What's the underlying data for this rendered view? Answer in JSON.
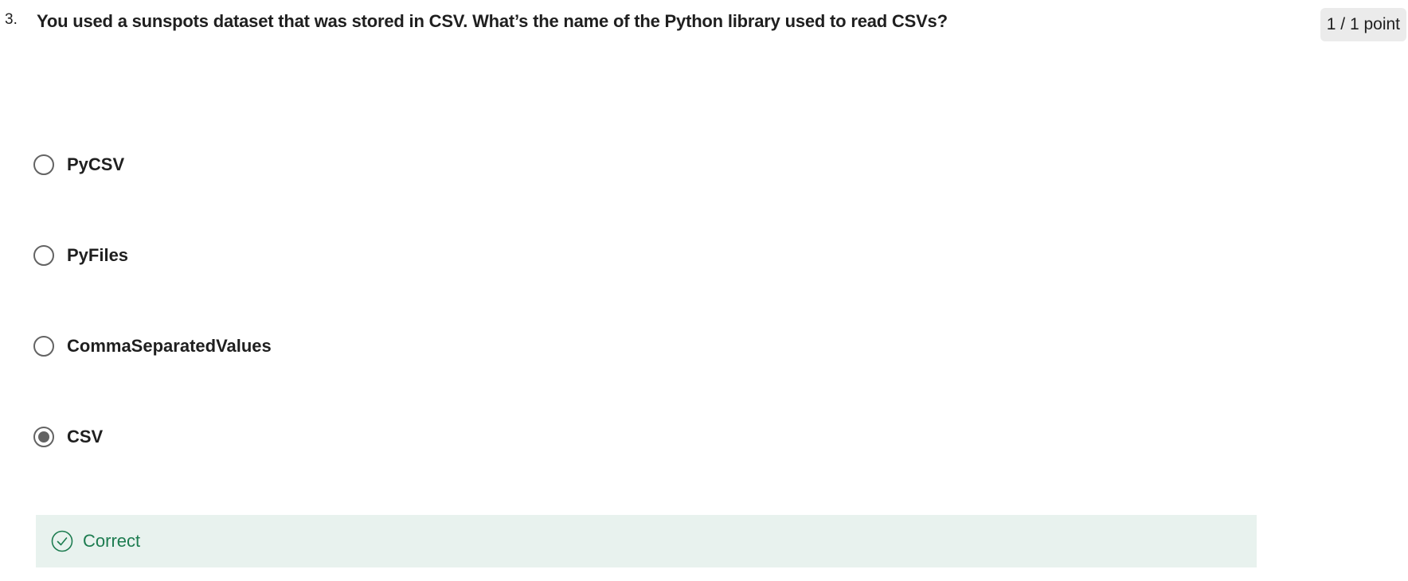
{
  "question": {
    "number": "3.",
    "text": "You used a sunspots dataset that was stored in CSV. What’s the name of the Python library used to read CSVs?",
    "points": "1 / 1 point"
  },
  "options": [
    {
      "label": "PyCSV",
      "selected": false
    },
    {
      "label": "PyFiles",
      "selected": false
    },
    {
      "label": "CommaSeparatedValues",
      "selected": false
    },
    {
      "label": "CSV",
      "selected": true
    }
  ],
  "feedback": {
    "status": "Correct",
    "icon": "check-circle-icon"
  },
  "colors": {
    "correct_text": "#1d7c50",
    "correct_bg": "#e8f2ee",
    "radio": "#636363",
    "points_bg": "#ebebeb"
  }
}
